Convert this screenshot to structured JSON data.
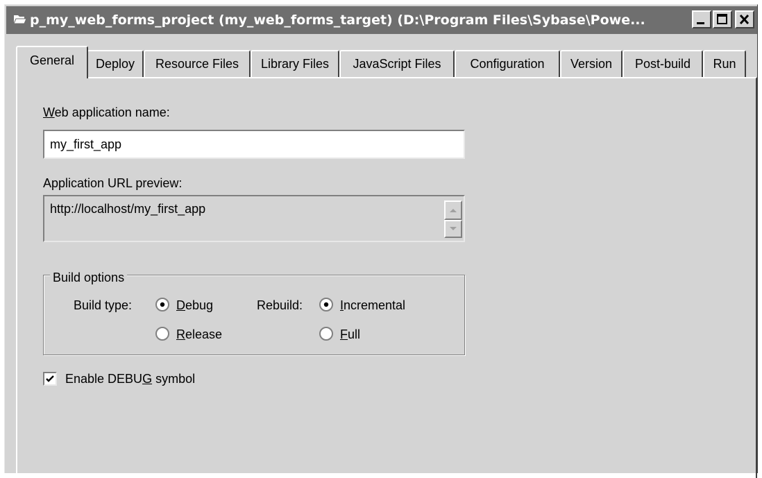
{
  "window": {
    "title": "p_my_web_forms_project (my_web_forms_target) (D:\\Program Files\\Sybase\\Powe...",
    "icon": "folder-icon",
    "controls": [
      "minimize-icon",
      "maximize-icon",
      "close-icon"
    ]
  },
  "tabs": [
    {
      "label": "General",
      "active": true
    },
    {
      "label": "Deploy"
    },
    {
      "label": "Resource Files"
    },
    {
      "label": "Library Files"
    },
    {
      "label": "JavaScript Files"
    },
    {
      "label": "Configuration"
    },
    {
      "label": "Version"
    },
    {
      "label": "Post-build"
    },
    {
      "label": "Run"
    }
  ],
  "general": {
    "app_name_label": {
      "accel": "W",
      "rest": "eb application name:"
    },
    "app_name_value": "my_first_app",
    "url_preview_label": "Application URL preview:",
    "url_preview_value": "http://localhost/my_first_app",
    "build_options": {
      "title": "Build options",
      "build_type_label": "Build type:",
      "debug": {
        "accel": "D",
        "rest": "ebug",
        "selected": true
      },
      "release": {
        "accel": "R",
        "rest": "elease",
        "selected": false
      },
      "rebuild_label": "Rebuild:",
      "incremental": {
        "accel": "I",
        "rest": "ncremental",
        "selected": true
      },
      "full": {
        "accel": "F",
        "rest": "ull",
        "selected": false
      }
    },
    "debug_symbol": {
      "before": "Enable DEBU",
      "accel": "G",
      "after": " symbol",
      "checked": true
    }
  },
  "colors": {
    "face": "#d4d4d4",
    "titlebar": "#6f6f6f",
    "highlight": "#ffffff",
    "shadow": "#808080",
    "dark_shadow": "#404040"
  }
}
